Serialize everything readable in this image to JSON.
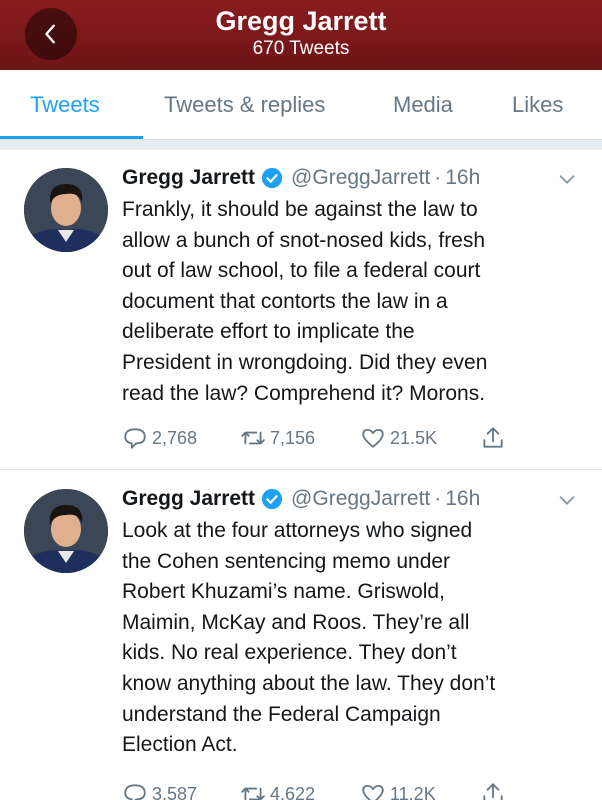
{
  "header": {
    "title": "Gregg Jarrett",
    "subtitle": "670 Tweets",
    "back_icon": "chevron-left-icon",
    "background_color": "#7a171a"
  },
  "tabs": [
    {
      "label": "Tweets",
      "active": true
    },
    {
      "label": "Tweets & replies",
      "active": false
    },
    {
      "label": "Media",
      "active": false
    },
    {
      "label": "Likes",
      "active": false
    }
  ],
  "accent_color": "#1da1f2",
  "tweets": [
    {
      "name": "Gregg Jarrett",
      "handle": "@GreggJarrett",
      "separator": "·",
      "time": "16h",
      "lines": [
        "Frankly, it should be against the law to",
        "allow a bunch of snot-nosed kids, fresh",
        "out of law school, to file a federal court",
        "document that contorts the law in a",
        "deliberate effort to implicate the",
        "President in wrongdoing.  Did they even",
        "read the law?  Comprehend it?  Morons."
      ],
      "replies": "2,768",
      "retweets": "7,156",
      "likes": "21.5K"
    },
    {
      "name": "Gregg Jarrett",
      "handle": "@GreggJarrett",
      "separator": "·",
      "time": "16h",
      "lines": [
        "Look at the four attorneys who signed",
        "the Cohen sentencing memo under",
        "Robert Khuzami’s name.  Griswold,",
        "Maimin, McKay and Roos. They’re all",
        "kids.  No real experience. They don’t",
        "know anything about the law.  They don’t",
        "understand the Federal Campaign",
        "Election Act."
      ],
      "replies": "3,587",
      "retweets": "4,622",
      "likes": "11.2K"
    }
  ]
}
